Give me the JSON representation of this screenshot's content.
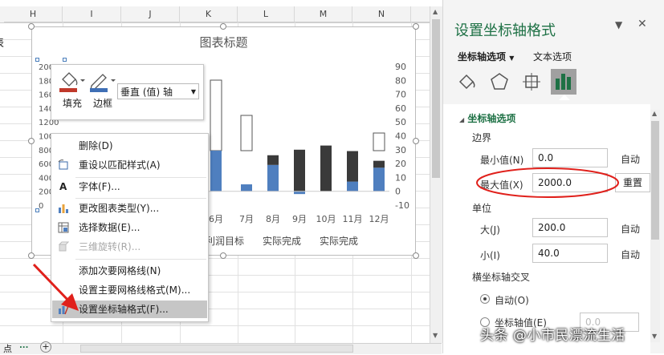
{
  "sheet": {
    "columns": [
      "H",
      "I",
      "J",
      "K",
      "L",
      "M",
      "N"
    ],
    "tabs_dots": "...",
    "cut_text_left": "表",
    "cut_text_bottom": "点"
  },
  "chart": {
    "title": "图表标题",
    "legend": [
      "利润目标",
      "实际完成",
      "实际完成"
    ],
    "selected_axis_ticks": [
      "2000",
      "1800",
      "1600",
      "1400",
      "1200",
      "1000",
      "800",
      "600",
      "400",
      "200",
      "0"
    ],
    "colors": {
      "blue": "#4f7fbf",
      "dark": "#3a3a3a",
      "outline": "#555555"
    }
  },
  "chart_data": {
    "type": "bar",
    "title": "图表标题",
    "categories": [
      "6月",
      "7月",
      "8月",
      "9月",
      "10月",
      "11月",
      "12月"
    ],
    "y2_ticks": [
      90,
      80,
      70,
      60,
      50,
      40,
      30,
      20,
      10,
      0,
      -10
    ],
    "ylim_right": [
      -10,
      90
    ],
    "series": [
      {
        "name": "利润目标",
        "type": "outline",
        "values": [
          null,
          null,
          null,
          null,
          null,
          null,
          null
        ]
      },
      {
        "name": "实际完成",
        "values": [
          null,
          5,
          19,
          -2,
          null,
          7,
          17
        ]
      },
      {
        "name": "实际完成",
        "values": [
          null,
          null,
          26,
          30,
          33,
          29,
          22
        ]
      }
    ]
  },
  "minibar": {
    "fill_label": "填充",
    "border_label": "边框",
    "select_value": "垂直 (值) 轴"
  },
  "context_menu": {
    "items": [
      {
        "label": "删除(D)",
        "icon": "none-icon",
        "disabled": false
      },
      {
        "label": "重设以匹配样式(A)",
        "icon": "reset-style-icon",
        "disabled": false
      },
      {
        "label": "字体(F)...",
        "icon": "font-a-icon",
        "disabled": false
      },
      {
        "label": "更改图表类型(Y)...",
        "icon": "chart-type-icon",
        "disabled": false
      },
      {
        "label": "选择数据(E)...",
        "icon": "select-data-icon",
        "disabled": false
      },
      {
        "label": "三维旋转(R)...",
        "icon": "3d-rotate-icon",
        "disabled": true
      },
      {
        "label": "添加次要网格线(N)",
        "icon": "none-icon",
        "disabled": false
      },
      {
        "label": "设置主要网格线格式(M)...",
        "icon": "none-icon",
        "disabled": false
      },
      {
        "label": "设置坐标轴格式(F)...",
        "icon": "format-axis-icon",
        "disabled": false,
        "highlighted": true
      }
    ]
  },
  "pane": {
    "title": "设置坐标轴格式",
    "tab_axis_options": "坐标轴选项",
    "tab_text_options": "文本选项",
    "section": "坐标轴选项",
    "bounds_label": "边界",
    "min_label": "最小值(N)",
    "min_value": "0.0",
    "min_btn": "自动",
    "max_label": "最大值(X)",
    "max_value": "2000.0",
    "max_btn": "重置",
    "units_label": "单位",
    "major_label": "大(J)",
    "major_value": "200.0",
    "major_btn": "自动",
    "minor_label": "小(I)",
    "minor_value": "40.0",
    "minor_btn": "自动",
    "cross_label": "横坐标轴交叉",
    "radio_auto": "自动(O)",
    "radio_value": "坐标轴值(E)",
    "radio_value_input": "0.0",
    "colors": {
      "accent": "#1e7145",
      "highlight_ring": "#e0201b"
    }
  },
  "watermark": "头条 @小市民漂流生活"
}
